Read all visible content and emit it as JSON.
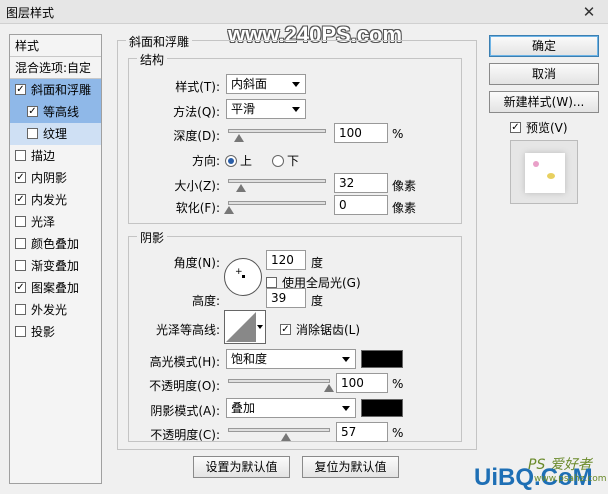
{
  "window": {
    "title": "图层样式",
    "close_glyph": "✕"
  },
  "watermark": "www.240PS.com",
  "sidebar": {
    "header": "样式",
    "blend": "混合选项:自定",
    "items": [
      {
        "label": "斜面和浮雕",
        "checked": true
      },
      {
        "label": "等高线",
        "checked": true
      },
      {
        "label": "纹理",
        "checked": false
      },
      {
        "label": "描边",
        "checked": false
      },
      {
        "label": "内阴影",
        "checked": true
      },
      {
        "label": "内发光",
        "checked": true
      },
      {
        "label": "光泽",
        "checked": false
      },
      {
        "label": "颜色叠加",
        "checked": false
      },
      {
        "label": "渐变叠加",
        "checked": false
      },
      {
        "label": "图案叠加",
        "checked": true
      },
      {
        "label": "外发光",
        "checked": false
      },
      {
        "label": "投影",
        "checked": false
      }
    ]
  },
  "bevel": {
    "group_title": "斜面和浮雕",
    "structure_title": "结构",
    "style_label": "样式(T):",
    "style_value": "内斜面",
    "method_label": "方法(Q):",
    "method_value": "平滑",
    "depth_label": "深度(D):",
    "depth_value": "100",
    "depth_unit": "%",
    "depth_level": 0.1,
    "direction_label": "方向:",
    "dir_up": "上",
    "dir_down": "下",
    "direction": "上",
    "size_label": "大小(Z):",
    "size_value": "32",
    "size_unit": "像素",
    "size_level": 0.13,
    "soften_label": "软化(F):",
    "soften_value": "0",
    "soften_unit": "像素",
    "soften_level": 0.0
  },
  "shading": {
    "title": "阴影",
    "angle_label": "角度(N):",
    "angle_value": "120",
    "angle_unit": "度",
    "global_light_label": "使用全局光(G)",
    "global_light": false,
    "altitude_label": "高度:",
    "altitude_value": "39",
    "altitude_unit": "度",
    "gloss_label": "光泽等高线:",
    "antialias_label": "消除锯齿(L)",
    "antialias": true,
    "highlight_label": "高光模式(H):",
    "highlight_mode": "饱和度",
    "highlight_color": "#000000",
    "hl_opacity_label": "不透明度(O):",
    "hl_opacity_value": "100",
    "hl_opacity_unit": "%",
    "hl_opacity_level": 1.0,
    "shadow_label": "阴影模式(A):",
    "shadow_mode": "叠加",
    "shadow_color": "#000000",
    "sh_opacity_label": "不透明度(C):",
    "sh_opacity_value": "57",
    "sh_opacity_unit": "%",
    "sh_opacity_level": 0.57
  },
  "buttons": {
    "ok": "确定",
    "cancel": "取消",
    "new_style": "新建样式(W)...",
    "preview_label": "预览(V)",
    "preview": true,
    "set_default": "设置为默认值",
    "reset_default": "复位为默认值"
  },
  "logo": {
    "main": "UiBQ.CoM",
    "cn": "PS 爱好者",
    "url": "www.psahz.com"
  }
}
